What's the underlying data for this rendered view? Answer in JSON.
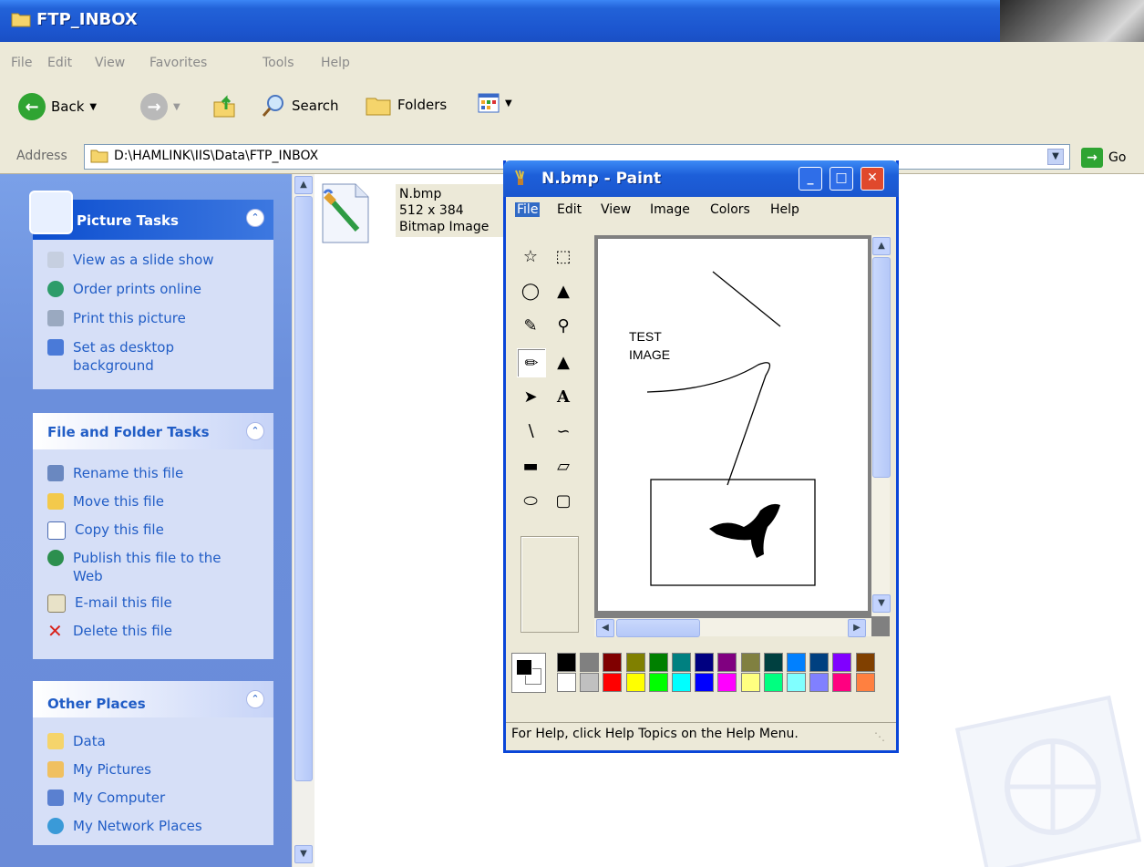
{
  "explorer": {
    "title": "FTP_INBOX",
    "menu": [
      "File",
      "Edit",
      "View",
      "Favorites",
      "Tools",
      "Help"
    ],
    "toolbar": {
      "back": "Back",
      "search": "Search",
      "folders": "Folders"
    },
    "address": {
      "label": "Address",
      "value": "D:\\HAMLINK\\IIS\\Data\\FTP_INBOX",
      "go": "Go"
    }
  },
  "tasks": {
    "picture": {
      "title": "Picture Tasks",
      "items": [
        "View as a slide show",
        "Order prints online",
        "Print this picture",
        "Set as desktop background"
      ]
    },
    "file": {
      "title": "File and Folder Tasks",
      "items": [
        "Rename this file",
        "Move this file",
        "Copy this file",
        "Publish this file to the Web",
        "E-mail this file",
        "Delete this file"
      ]
    },
    "places": {
      "title": "Other Places",
      "items": [
        "Data",
        "My Pictures",
        "My Computer",
        "My Network Places"
      ]
    }
  },
  "file_item": {
    "name": "N.bmp",
    "dims": "512 x 384",
    "type": "Bitmap Image"
  },
  "paint": {
    "title": "N.bmp - Paint",
    "menu": [
      "File",
      "Edit",
      "View",
      "Image",
      "Colors",
      "Help"
    ],
    "canvas_text": [
      "TEST",
      "IMAGE"
    ],
    "status": "For Help, click Help Topics on the Help Menu.",
    "palette_top": [
      "#000000",
      "#808080",
      "#800000",
      "#808000",
      "#008000",
      "#008080",
      "#000080",
      "#800080",
      "#808040",
      "#004040",
      "#0080ff",
      "#004080",
      "#8000ff",
      "#804000"
    ],
    "palette_bottom": [
      "#ffffff",
      "#c0c0c0",
      "#ff0000",
      "#ffff00",
      "#00ff00",
      "#00ffff",
      "#0000ff",
      "#ff00ff",
      "#ffff80",
      "#00ff80",
      "#80ffff",
      "#8080ff",
      "#ff0080",
      "#ff8040"
    ]
  }
}
